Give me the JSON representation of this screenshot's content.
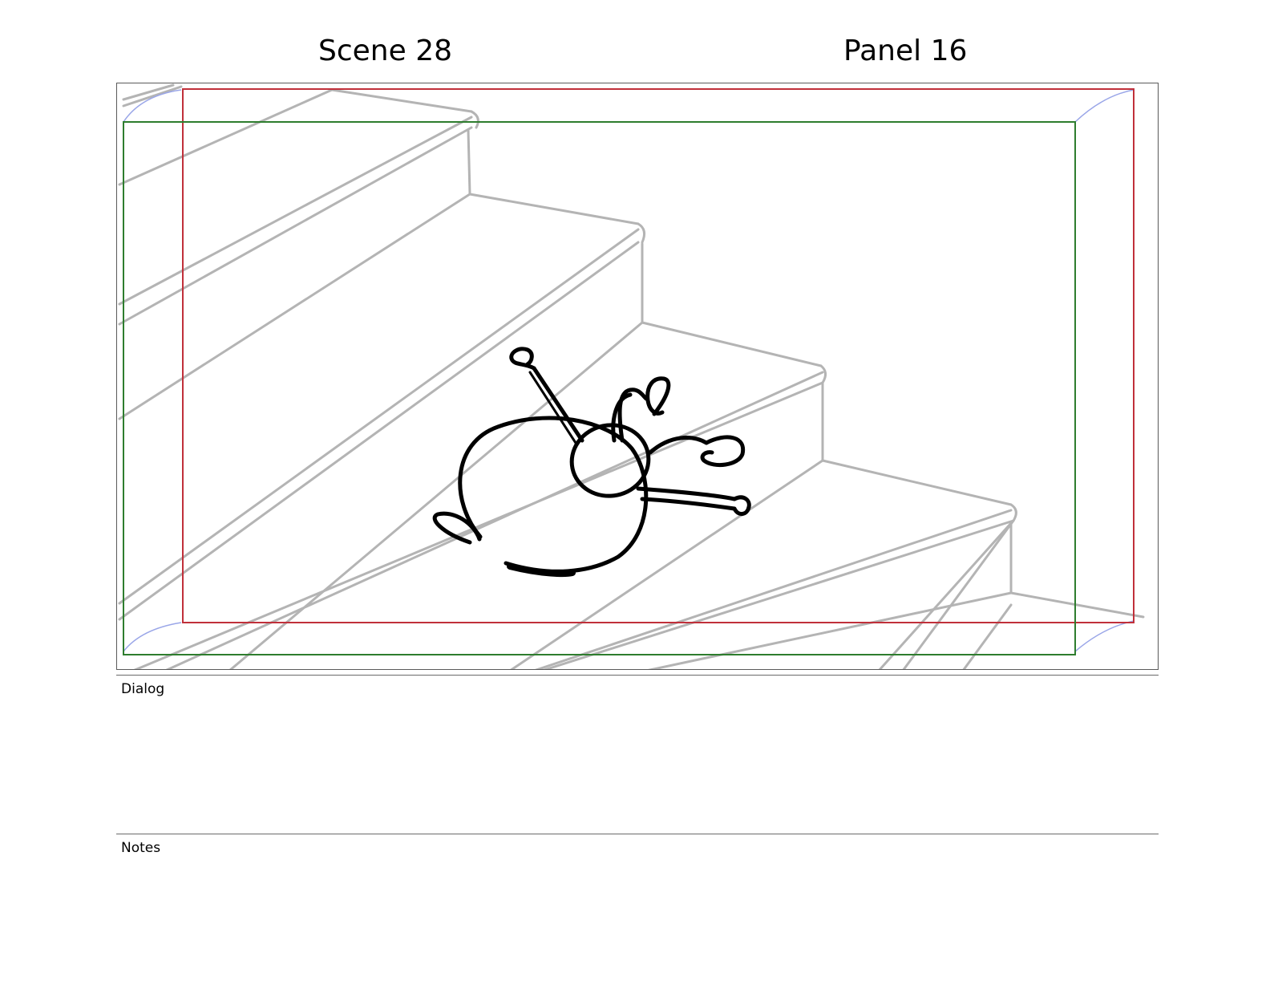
{
  "header": {
    "scene_label": "Scene 28",
    "panel_label": "Panel 16"
  },
  "panel": {
    "image_alt": "Storyboard sketch of a round cartoon character tumbling on a staircase",
    "safe_frame_color": "#c0303a",
    "action_frame_color": "#2e7d2e",
    "stair_sketch_color": "#b4b4b4",
    "character_line_color": "#000000"
  },
  "dialog": {
    "label": "Dialog",
    "text": ""
  },
  "notes": {
    "label": "Notes",
    "text": ""
  }
}
